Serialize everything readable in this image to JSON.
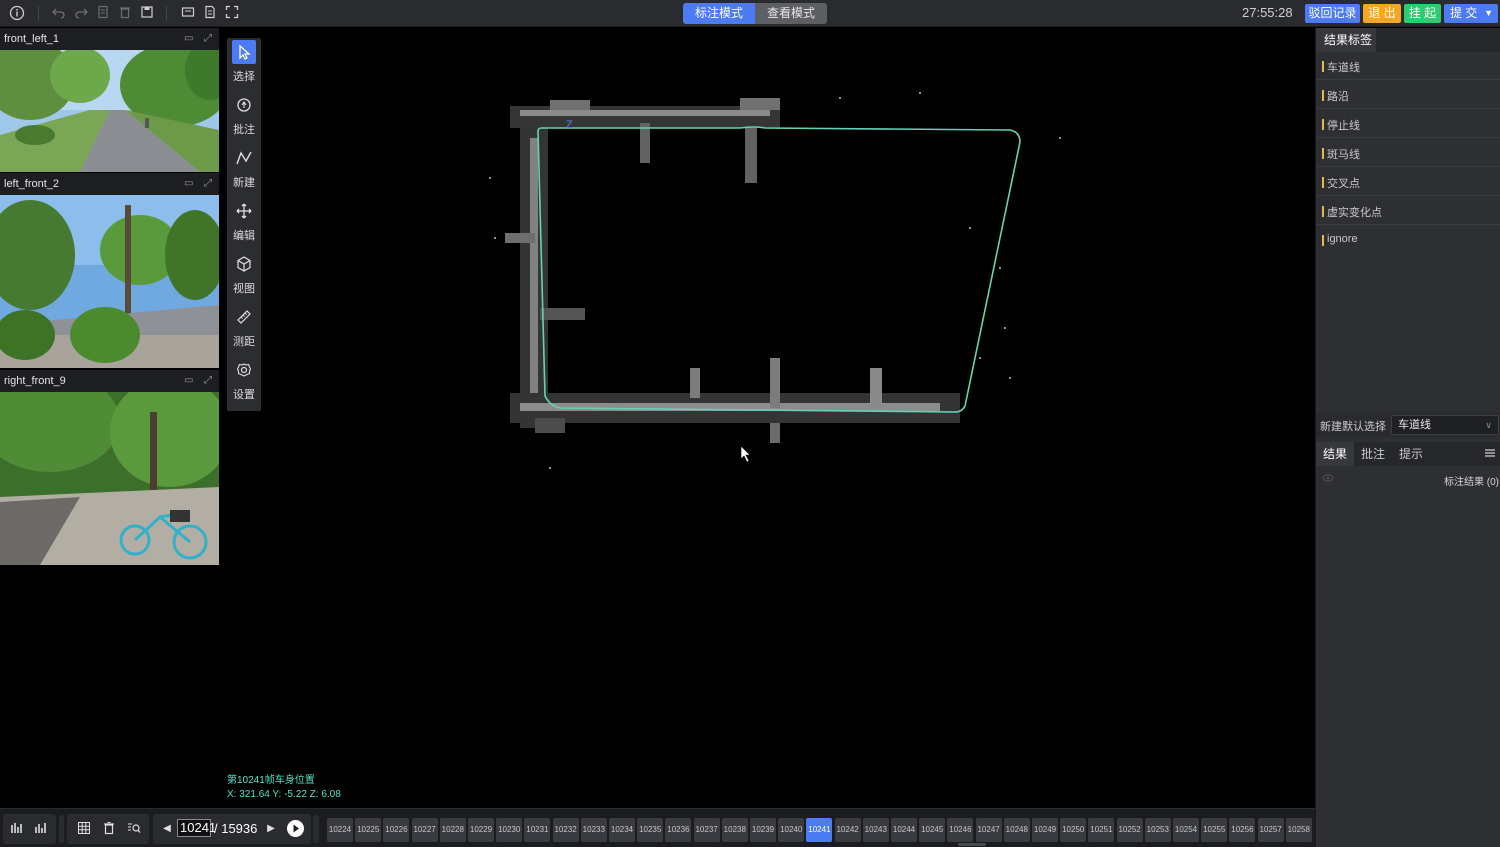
{
  "topbar": {
    "mode_active": "标注模式",
    "mode_inactive": "查看模式",
    "timer": "27:55:28",
    "buttons": [
      {
        "label": "驳回记录",
        "color": "#4d7bf3"
      },
      {
        "label": "退 出",
        "color": "#f5a623"
      },
      {
        "label": "挂 起",
        "color": "#2ecc71"
      },
      {
        "label": "提 交",
        "color": "#4d7bf3"
      }
    ]
  },
  "cameras": [
    {
      "name": "front_left_1"
    },
    {
      "name": "left_front_2"
    },
    {
      "name": "right_front_9"
    }
  ],
  "tools": [
    {
      "label": "选择"
    },
    {
      "label": "批注"
    },
    {
      "label": "新建"
    },
    {
      "label": "编辑"
    },
    {
      "label": "视图"
    },
    {
      "label": "测距"
    },
    {
      "label": "设置"
    }
  ],
  "viewport": {
    "pos_title": "第10241帧车身位置",
    "pos_coords": "X: 321.64   Y: -5.22   Z: 6.08"
  },
  "right_panel": {
    "tab": "结果标签",
    "labels": [
      {
        "name": "车道线",
        "color": "#e5b94b"
      },
      {
        "name": "路沿",
        "color": "#e5b94b"
      },
      {
        "name": "停止线",
        "color": "#e5b94b"
      },
      {
        "name": "斑马线",
        "color": "#e5b94b"
      },
      {
        "name": "交叉点",
        "color": "#e5b94b"
      },
      {
        "name": "虚实变化点",
        "color": "#e5b94b"
      },
      {
        "name": "ignore",
        "color": "#e5b94b"
      }
    ],
    "default_label": "新建默认选择",
    "default_value": "车道线",
    "result_tabs": [
      "结果",
      "批注",
      "提示"
    ],
    "result_summary": "标注结果 (0)"
  },
  "bottombar": {
    "frame_current": "10241",
    "frame_total": "/ 15936",
    "frames": [
      "10224",
      "10225",
      "10226",
      "10227",
      "10228",
      "10229",
      "10230",
      "10231",
      "10232",
      "10233",
      "10234",
      "10235",
      "10236",
      "10237",
      "10238",
      "10239",
      "10240",
      "10241",
      "10242",
      "10243",
      "10244",
      "10245",
      "10246",
      "10247",
      "10248",
      "10249",
      "10250",
      "10251",
      "10252",
      "10253",
      "10254",
      "10255",
      "10256",
      "10257",
      "10258"
    ],
    "active_frame": "10241"
  }
}
